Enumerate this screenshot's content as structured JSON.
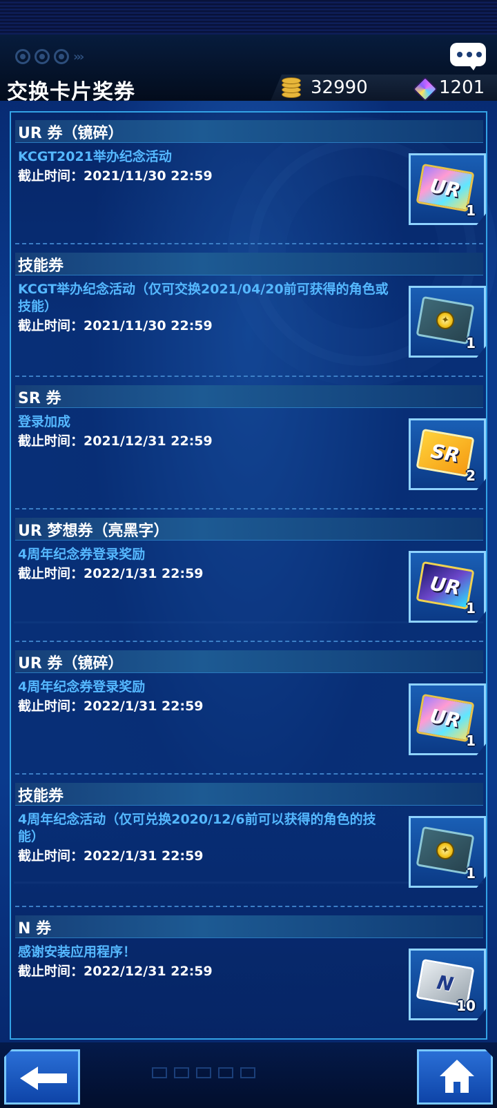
{
  "header": {
    "title": "交换卡片奖券",
    "coins": "32990",
    "gems": "1201",
    "icons": {
      "coins": "gold-coin-stack-icon",
      "gems": "gem-icon",
      "chat": "chat-bubble-icon"
    }
  },
  "vouchers": [
    {
      "title": "UR 券（镜碎）",
      "desc": "KCGT2021举办纪念活动",
      "deadline": "截止时间：2021/11/30 22:59",
      "ticket_label": "UR",
      "count": "1"
    },
    {
      "title": "技能券",
      "desc": "KCGT举办纪念活动（仅可交换2021/04/20前可获得的角色或技能）",
      "deadline": "截止时间：2021/11/30 22:59",
      "ticket_label": "",
      "count": "1"
    },
    {
      "title": "SR 券",
      "desc": "登录加成",
      "deadline": "截止时间：2021/12/31 22:59",
      "ticket_label": "SR",
      "count": "2"
    },
    {
      "title": "UR 梦想券（亮黑字）",
      "desc": "4周年纪念券登录奖励",
      "deadline": "截止时间：2022/1/31 22:59",
      "ticket_label": "UR",
      "count": "1"
    },
    {
      "title": "UR 券（镜碎）",
      "desc": "4周年纪念券登录奖励",
      "deadline": "截止时间：2022/1/31 22:59",
      "ticket_label": "UR",
      "count": "1"
    },
    {
      "title": "技能券",
      "desc": "4周年纪念活动（仅可兑换2020/12/6前可以获得的角色的技能）",
      "deadline": "截止时间：2022/1/31 22:59",
      "ticket_label": "",
      "count": "1"
    },
    {
      "title": "N 券",
      "desc": "感谢安装应用程序！",
      "deadline": "截止时间：2022/12/31 22:59",
      "ticket_label": "N",
      "count": "10"
    }
  ],
  "footer": {
    "back_icon": "back-arrow-icon",
    "home_icon": "home-icon"
  },
  "colors": {
    "panel_border": "#33a3e6",
    "desc_text": "#55b8ff",
    "header_bar": "#1d5a93",
    "button_blue": "#1553bb"
  }
}
